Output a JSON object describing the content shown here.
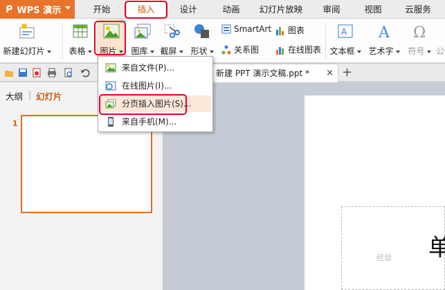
{
  "app": {
    "name": "WPS 演示"
  },
  "menu": {
    "items": [
      "开始",
      "插入",
      "设计",
      "动画",
      "幻灯片放映",
      "审阅",
      "视图",
      "云服务"
    ],
    "active": "插入"
  },
  "ribbon": {
    "new_slide": "新建幻灯片",
    "table": "表格",
    "picture": "图片",
    "gallery": "图库",
    "screenshot": "截屏",
    "shape": "形状",
    "smartart": "SmartArt",
    "chart": "图表",
    "relation": "关系图",
    "online_chart": "在线图表",
    "textbox": "文本框",
    "wordart": "艺术字",
    "symbol": "符号",
    "formula_partial": "公"
  },
  "dropdown": {
    "items": [
      "来自文件(P)...",
      "在线图片(I)...",
      "分页插入图片(S)...",
      "来自手机(M)..."
    ],
    "highlighted": 2
  },
  "document": {
    "tab_title": "新建 PPT 演示文稿.ppt *",
    "close": "×",
    "add": "+"
  },
  "left_panel": {
    "tab_outline": "大纲",
    "divider": "|",
    "tab_slides": "幻灯片",
    "slide_number": "1"
  },
  "canvas": {
    "visible_char": "单"
  },
  "watermark": "经验",
  "colors": {
    "accent": "#e8732a",
    "highlight_box": "#e5002b",
    "menu_highlight": "#fde7d8"
  }
}
